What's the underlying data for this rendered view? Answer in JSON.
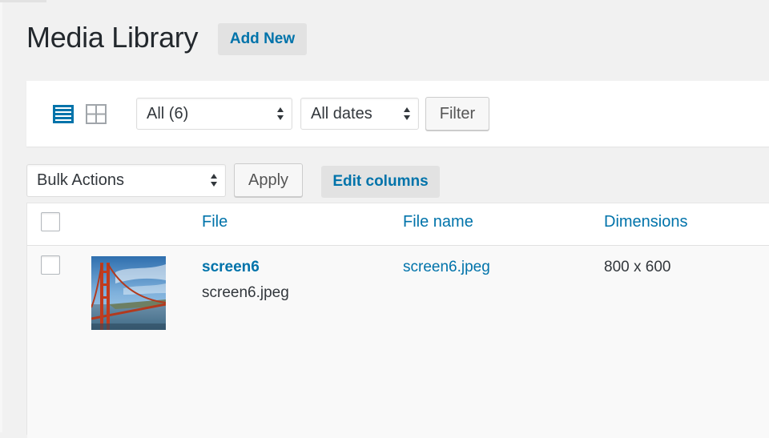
{
  "page": {
    "title": "Media Library",
    "add_new_label": "Add New"
  },
  "filters": {
    "media_type_selected": "All (6)",
    "date_selected": "All dates",
    "filter_button": "Filter",
    "view_modes": [
      "list-view-icon",
      "grid-view-icon"
    ],
    "active_view": "list"
  },
  "bulk": {
    "selected": "Bulk Actions",
    "apply_button": "Apply",
    "edit_columns": "Edit columns"
  },
  "table": {
    "columns": [
      "File",
      "File name",
      "Dimensions"
    ],
    "rows": [
      {
        "title": "screen6",
        "filename_sub": "screen6.jpeg",
        "file_name": "screen6.jpeg",
        "dimensions": "800 x 600",
        "thumbnail": "golden-gate-bridge-thumbnail"
      }
    ]
  },
  "colors": {
    "link": "#0073aa",
    "background": "#f1f1f1",
    "panel": "#ffffff",
    "active_icon": "#0073aa",
    "inactive_icon": "#a0a5aa"
  }
}
